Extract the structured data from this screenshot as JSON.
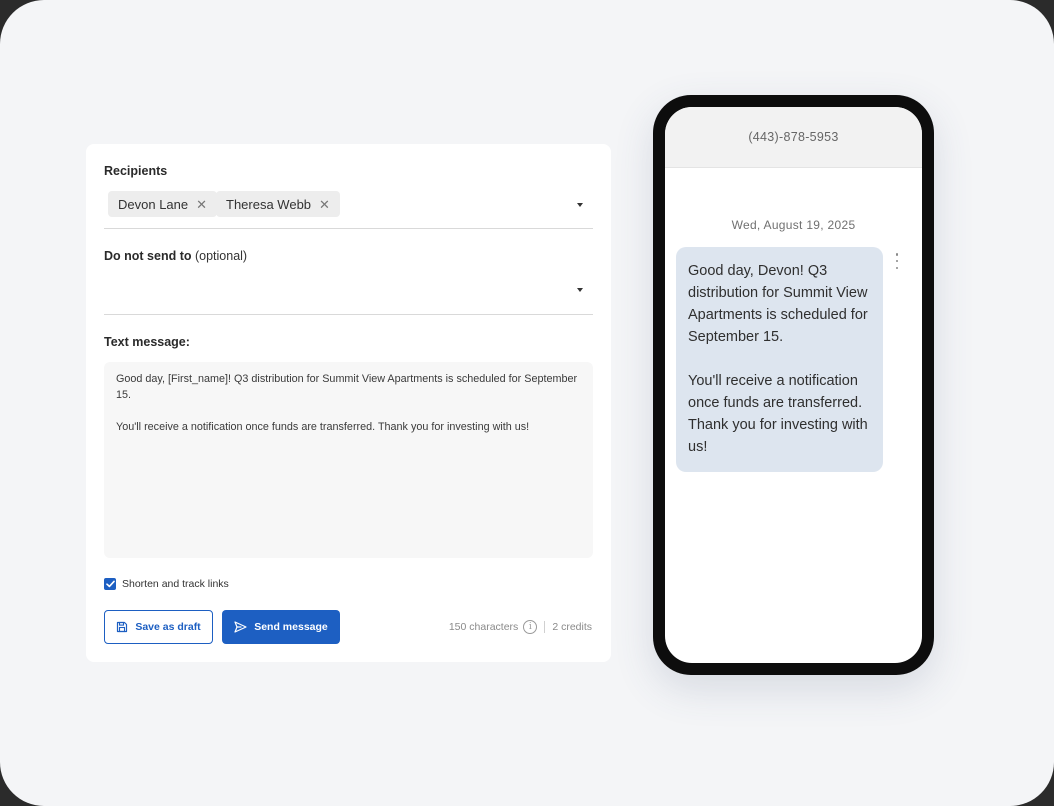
{
  "composer": {
    "recipients_label": "Recipients",
    "recipients": [
      {
        "name": "Devon Lane"
      },
      {
        "name": "Theresa Webb"
      }
    ],
    "do_not_send_label": "Do not send to",
    "do_not_send_optional": "(optional)",
    "text_message_label": "Text message:",
    "message_paragraphs": [
      "Good day, [First_name]! Q3 distribution for Summit View Apartments is scheduled for September 15.",
      "You'll receive a notification once funds are transferred. Thank you for investing with us!"
    ],
    "shorten_links": {
      "label": "Shorten and track links",
      "checked": true
    },
    "save_draft_label": "Save as draft",
    "send_label": "Send message",
    "characters": "150 characters",
    "credits": "2 credits"
  },
  "phone": {
    "number": "(443)-878-5953",
    "date": "Wed, August 19, 2025",
    "bubble_paragraphs": [
      "Good day, Devon! Q3 distribution for Summit View Apartments is scheduled for September 15.",
      "You'll receive a notification once funds are transferred. Thank you for investing with us!"
    ]
  },
  "colors": {
    "accent": "#1d5fc2",
    "bubble": "#dde5ef",
    "background": "#f4f5f7"
  }
}
